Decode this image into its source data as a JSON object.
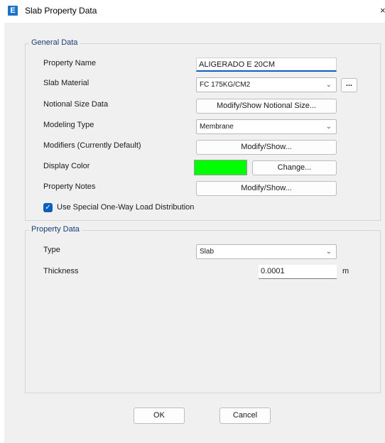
{
  "window": {
    "title": "Slab Property Data",
    "app_icon_letter": "E",
    "close_glyph": "×"
  },
  "general": {
    "title": "General Data",
    "property_name_label": "Property Name",
    "property_name_value": "ALIGERADO E 20CM",
    "slab_material_label": "Slab Material",
    "slab_material_value": "FC 175KG/CM2",
    "ellipsis": "...",
    "notional_label": "Notional Size Data",
    "notional_button": "Modify/Show Notional Size...",
    "modeling_type_label": "Modeling Type",
    "modeling_type_value": "Membrane",
    "modifiers_label": "Modifiers (Currently Default)",
    "modifiers_button": "Modify/Show...",
    "display_color_label": "Display Color",
    "display_color_value": "#00ff00",
    "change_button": "Change...",
    "notes_label": "Property Notes",
    "notes_button": "Modify/Show...",
    "one_way_label": "Use Special One-Way Load Distribution",
    "one_way_checked": true
  },
  "property": {
    "title": "Property Data",
    "type_label": "Type",
    "type_value": "Slab",
    "thickness_label": "Thickness",
    "thickness_value": "0.0001",
    "thickness_unit": "m"
  },
  "buttons": {
    "ok": "OK",
    "cancel": "Cancel"
  },
  "icons": {
    "dropdown": "chevron-down-icon",
    "check": "check-icon"
  }
}
